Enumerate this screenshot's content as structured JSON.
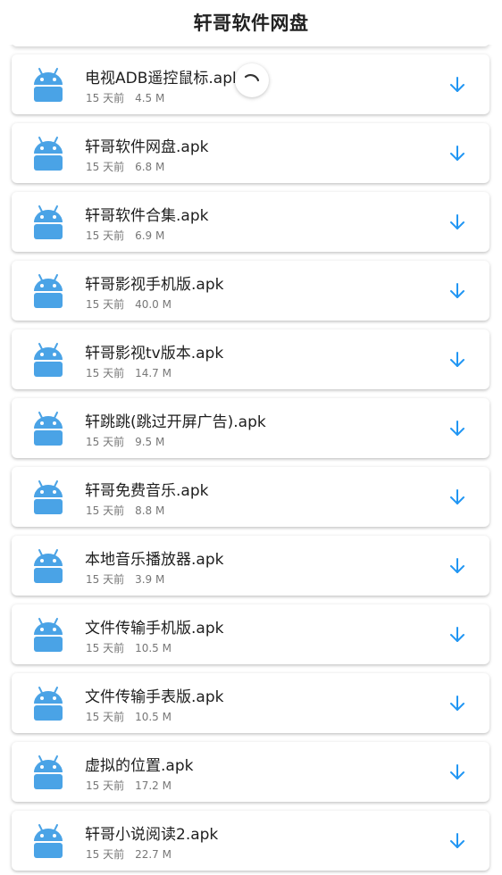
{
  "header": {
    "title": "轩哥软件网盘"
  },
  "colors": {
    "accent": "#2196f3",
    "android": "#4aa3e6"
  },
  "icons": {
    "file_icon": "android-icon",
    "action_icon": "download-arrow-icon",
    "loading": "loading-spinner"
  },
  "files": [
    {
      "name": "电视ADB遥控鼠标.apk",
      "age": "15 天前",
      "size": "4.5 M"
    },
    {
      "name": "轩哥软件网盘.apk",
      "age": "15 天前",
      "size": "6.8 M"
    },
    {
      "name": "轩哥软件合集.apk",
      "age": "15 天前",
      "size": "6.9 M"
    },
    {
      "name": "轩哥影视手机版.apk",
      "age": "15 天前",
      "size": "40.0 M"
    },
    {
      "name": "轩哥影视tv版本.apk",
      "age": "15 天前",
      "size": "14.7 M"
    },
    {
      "name": "轩跳跳(跳过开屏广告).apk",
      "age": "15 天前",
      "size": "9.5 M"
    },
    {
      "name": "轩哥免费音乐.apk",
      "age": "15 天前",
      "size": "8.8 M"
    },
    {
      "name": "本地音乐播放器.apk",
      "age": "15 天前",
      "size": "3.9 M"
    },
    {
      "name": "文件传输手机版.apk",
      "age": "15 天前",
      "size": "10.5 M"
    },
    {
      "name": "文件传输手表版.apk",
      "age": "15 天前",
      "size": "10.5 M"
    },
    {
      "name": "虚拟的位置.apk",
      "age": "15 天前",
      "size": "17.2 M"
    },
    {
      "name": "轩哥小说阅读2.apk",
      "age": "15 天前",
      "size": "22.7 M"
    }
  ]
}
